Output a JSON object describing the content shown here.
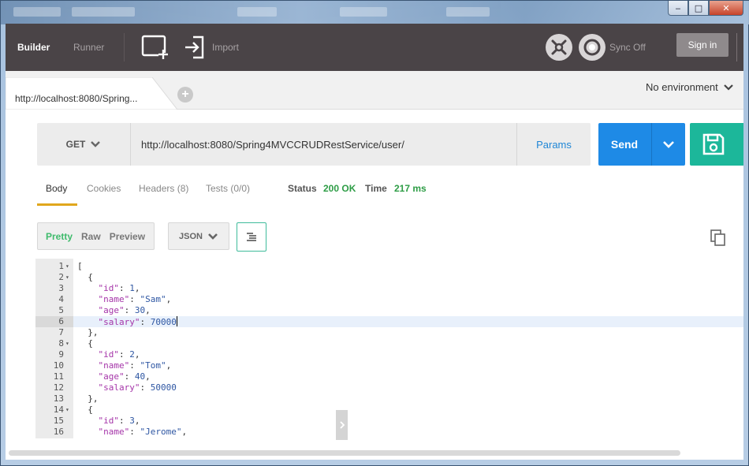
{
  "window": {
    "minimize_glyph": "‒",
    "maximize_glyph": "□",
    "close_glyph": "✕"
  },
  "toolbar": {
    "builder_label": "Builder",
    "runner_label": "Runner",
    "import_label": "Import",
    "sync_label": "Sync Off",
    "signin_label": "Sign in",
    "icons": [
      "new-tab-icon",
      "import-icon",
      "interceptor-icon",
      "sync-icon"
    ]
  },
  "tabs": {
    "items": [
      {
        "label": "http://localhost:8080/Spring..."
      }
    ],
    "add_glyph": "+",
    "environment_label": "No environment"
  },
  "request": {
    "method": "GET",
    "url": "http://localhost:8080/Spring4MVCCRUDRestService/user/",
    "params_label": "Params",
    "send_label": "Send"
  },
  "response": {
    "tabs": {
      "body": "Body",
      "cookies": "Cookies",
      "headers": "Headers (8)",
      "tests": "Tests (0/0)"
    },
    "status_label": "Status",
    "status_value": "200 OK",
    "time_label": "Time",
    "time_value": "217 ms",
    "view_modes": {
      "pretty": "Pretty",
      "raw": "Raw",
      "preview": "Preview"
    },
    "format": "JSON"
  },
  "editor": {
    "active_line": 6,
    "lines": [
      {
        "n": "1",
        "fold": true,
        "tokens": [
          {
            "t": "p",
            "v": "["
          }
        ]
      },
      {
        "n": "2",
        "fold": true,
        "tokens": [
          {
            "t": "p",
            "v": "  {"
          }
        ]
      },
      {
        "n": "3",
        "tokens": [
          {
            "t": "p",
            "v": "    "
          },
          {
            "t": "k",
            "v": "\"id\""
          },
          {
            "t": "p",
            "v": ": "
          },
          {
            "t": "n",
            "v": "1"
          },
          {
            "t": "p",
            "v": ","
          }
        ]
      },
      {
        "n": "4",
        "tokens": [
          {
            "t": "p",
            "v": "    "
          },
          {
            "t": "k",
            "v": "\"name\""
          },
          {
            "t": "p",
            "v": ": "
          },
          {
            "t": "s",
            "v": "\"Sam\""
          },
          {
            "t": "p",
            "v": ","
          }
        ]
      },
      {
        "n": "5",
        "tokens": [
          {
            "t": "p",
            "v": "    "
          },
          {
            "t": "k",
            "v": "\"age\""
          },
          {
            "t": "p",
            "v": ": "
          },
          {
            "t": "n",
            "v": "30"
          },
          {
            "t": "p",
            "v": ","
          }
        ]
      },
      {
        "n": "6",
        "tokens": [
          {
            "t": "p",
            "v": "    "
          },
          {
            "t": "k",
            "v": "\"salary\""
          },
          {
            "t": "p",
            "v": ": "
          },
          {
            "t": "n",
            "v": "70000"
          }
        ]
      },
      {
        "n": "7",
        "tokens": [
          {
            "t": "p",
            "v": "  },"
          }
        ]
      },
      {
        "n": "8",
        "fold": true,
        "tokens": [
          {
            "t": "p",
            "v": "  {"
          }
        ]
      },
      {
        "n": "9",
        "tokens": [
          {
            "t": "p",
            "v": "    "
          },
          {
            "t": "k",
            "v": "\"id\""
          },
          {
            "t": "p",
            "v": ": "
          },
          {
            "t": "n",
            "v": "2"
          },
          {
            "t": "p",
            "v": ","
          }
        ]
      },
      {
        "n": "10",
        "tokens": [
          {
            "t": "p",
            "v": "    "
          },
          {
            "t": "k",
            "v": "\"name\""
          },
          {
            "t": "p",
            "v": ": "
          },
          {
            "t": "s",
            "v": "\"Tom\""
          },
          {
            "t": "p",
            "v": ","
          }
        ]
      },
      {
        "n": "11",
        "tokens": [
          {
            "t": "p",
            "v": "    "
          },
          {
            "t": "k",
            "v": "\"age\""
          },
          {
            "t": "p",
            "v": ": "
          },
          {
            "t": "n",
            "v": "40"
          },
          {
            "t": "p",
            "v": ","
          }
        ]
      },
      {
        "n": "12",
        "tokens": [
          {
            "t": "p",
            "v": "    "
          },
          {
            "t": "k",
            "v": "\"salary\""
          },
          {
            "t": "p",
            "v": ": "
          },
          {
            "t": "n",
            "v": "50000"
          }
        ]
      },
      {
        "n": "13",
        "tokens": [
          {
            "t": "p",
            "v": "  },"
          }
        ]
      },
      {
        "n": "14",
        "fold": true,
        "tokens": [
          {
            "t": "p",
            "v": "  {"
          }
        ]
      },
      {
        "n": "15",
        "tokens": [
          {
            "t": "p",
            "v": "    "
          },
          {
            "t": "k",
            "v": "\"id\""
          },
          {
            "t": "p",
            "v": ": "
          },
          {
            "t": "n",
            "v": "3"
          },
          {
            "t": "p",
            "v": ","
          }
        ]
      },
      {
        "n": "16",
        "tokens": [
          {
            "t": "p",
            "v": "    "
          },
          {
            "t": "k",
            "v": "\"name\""
          },
          {
            "t": "p",
            "v": ": "
          },
          {
            "t": "s",
            "v": "\"Jerome\""
          },
          {
            "t": "p",
            "v": ","
          }
        ]
      }
    ]
  },
  "colors": {
    "toolbar_bg": "#4a4447",
    "send_blue": "#1e8ae6",
    "save_teal": "#1cb79a",
    "status_green": "#2e9d46",
    "tab_underline": "#e0a71d"
  }
}
